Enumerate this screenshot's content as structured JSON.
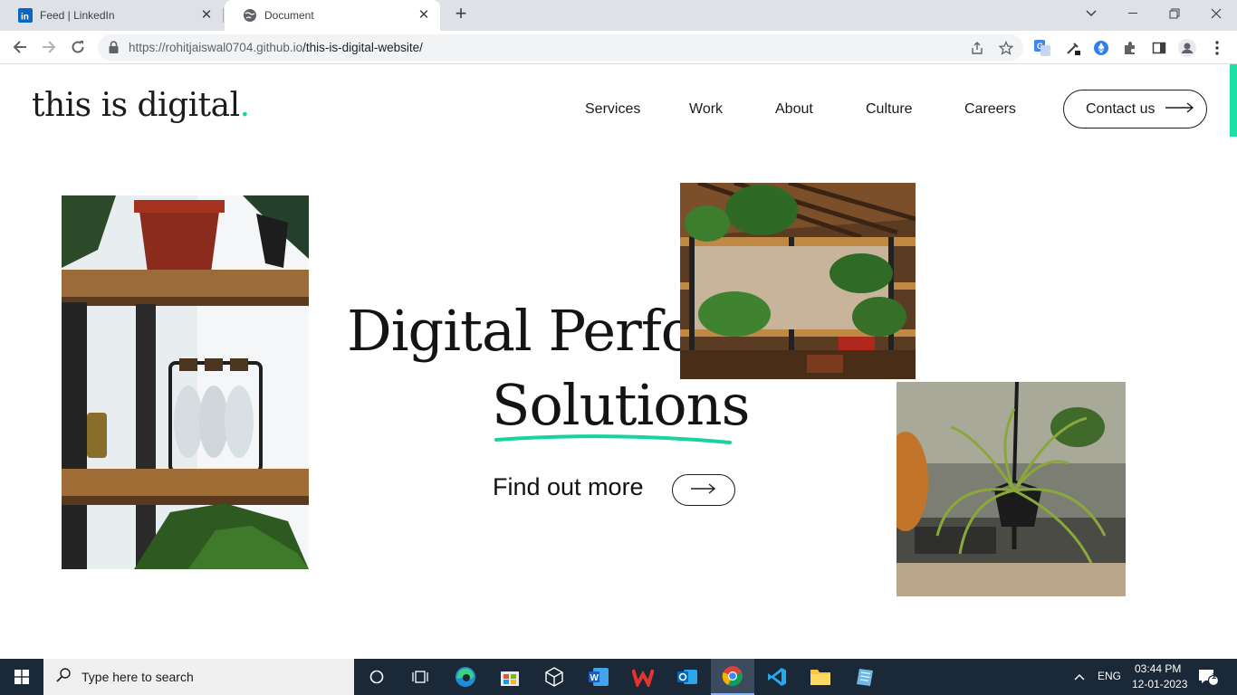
{
  "browser": {
    "tabs": [
      {
        "title": "Feed | LinkedIn",
        "icon": "linkedin-icon",
        "active": false
      },
      {
        "title": "Document",
        "icon": "globe-icon",
        "active": true
      }
    ],
    "url_host": "https://rohitjaiswal0704.github.io",
    "url_path": "/this-is-digital-website/"
  },
  "site": {
    "logo_text": "this is digital",
    "logo_dot": ".",
    "nav": [
      "Services",
      "Work",
      "About",
      "Culture",
      "Careers"
    ],
    "contact_label": "Contact us",
    "headline_line1": "Digital Performance",
    "headline_line2": "Solutions",
    "cta_label": "Find out more",
    "accent_color": "#18d39e"
  },
  "taskbar": {
    "search_placeholder": "Type here to search",
    "language": "ENG",
    "time": "03:44 PM",
    "date": "12-01-2023",
    "notification_count": "1",
    "pinned_apps": [
      "cortana-icon",
      "task-view-icon",
      "edge-icon",
      "store-icon",
      "3d-icon",
      "word-icon",
      "wps-icon",
      "outlook-icon",
      "chrome-icon",
      "vscode-icon",
      "file-explorer-icon",
      "notepad-icon"
    ]
  }
}
